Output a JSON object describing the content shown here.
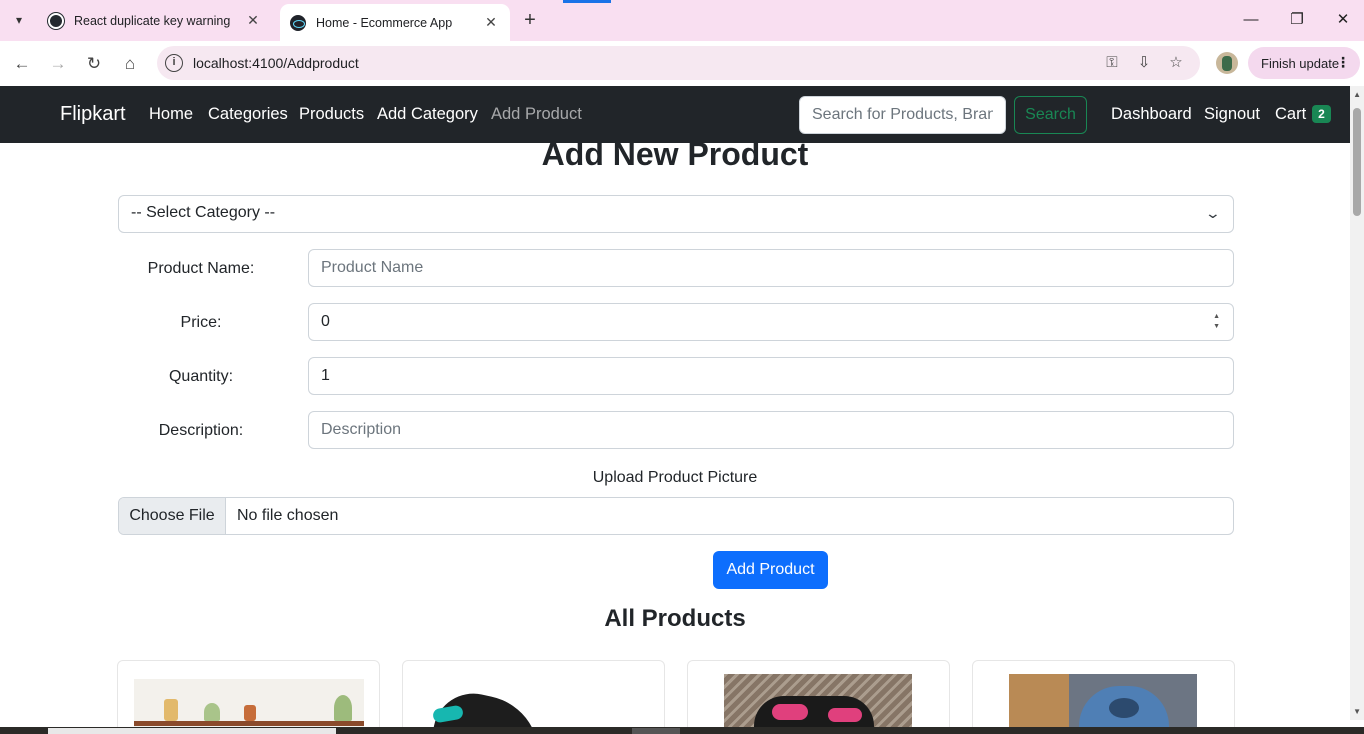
{
  "browser": {
    "tabs": [
      {
        "title": "React duplicate key warning",
        "active": false,
        "favicon": "github-icon"
      },
      {
        "title": "Home - Ecommerce App",
        "active": true,
        "favicon": "react-icon"
      }
    ],
    "url": "localhost:4100/Addproduct",
    "finish_update_label": "Finish update",
    "tab_strip_color": "#f9dff1"
  },
  "navbar": {
    "brand": "Flipkart",
    "links": [
      "Home",
      "Categories",
      "Products",
      "Add Category",
      "Add Product"
    ],
    "search_placeholder": "Search for Products, Brands and More",
    "search_button": "Search",
    "right_links": [
      "Dashboard",
      "Signout"
    ],
    "cart_label": "Cart",
    "cart_count": "2"
  },
  "form": {
    "title": "Add New Product",
    "category_select": "-- Select Category --",
    "product_name_label": "Product Name:",
    "product_name_placeholder": "Product Name",
    "price_label": "Price:",
    "price_value": "0",
    "quantity_label": "Quantity:",
    "quantity_value": "1",
    "description_label": "Description:",
    "description_placeholder": "Description",
    "upload_label": "Upload Product Picture",
    "choose_file_label": "Choose File",
    "file_status": "No file chosen",
    "submit_label": "Add Product"
  },
  "products_section": {
    "title": "All Products",
    "card_images": [
      "wall-shelf-image",
      "sneaker-image",
      "pink-sneaker-image",
      "blue-shoe-image"
    ]
  },
  "colors": {
    "navbar_bg": "#212529",
    "primary": "#0d6efd",
    "success": "#198754"
  }
}
